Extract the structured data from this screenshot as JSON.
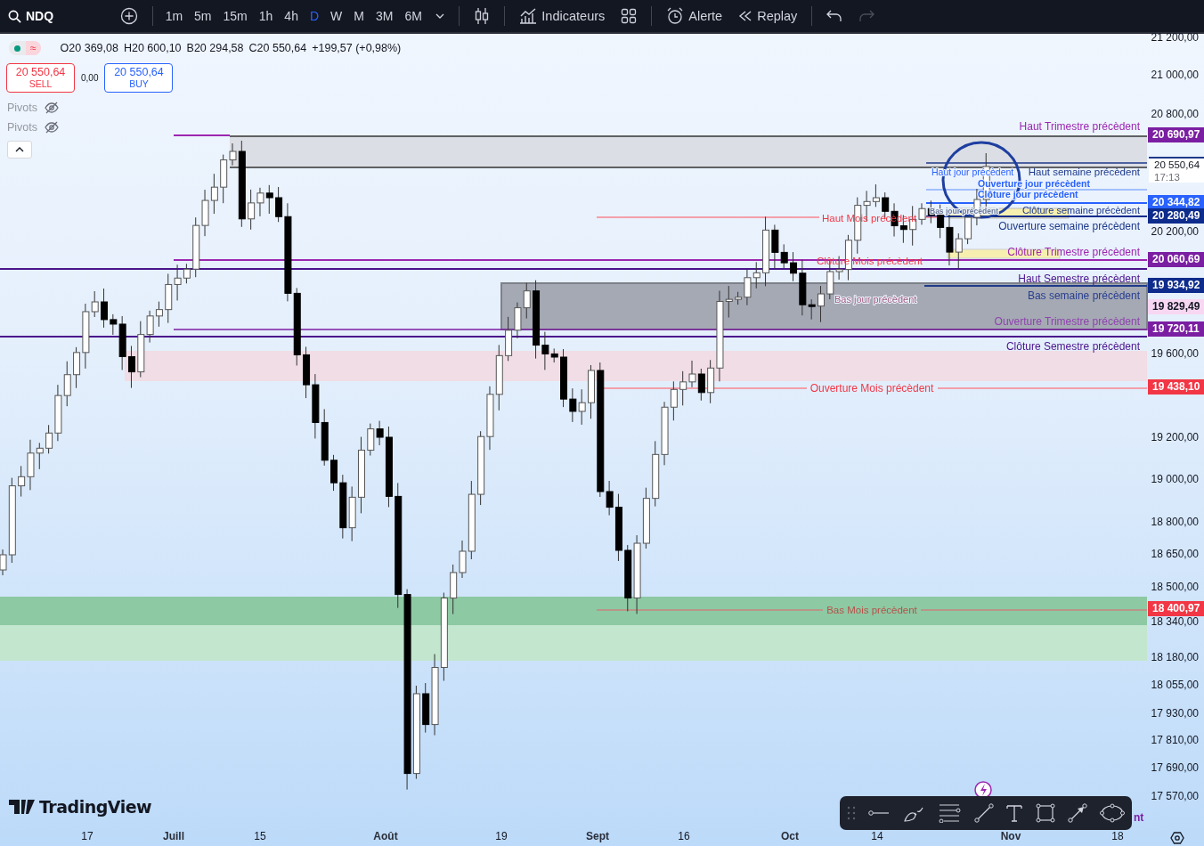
{
  "toolbar": {
    "symbol": "NDQ",
    "intervals": [
      {
        "label": "1m",
        "selected": false
      },
      {
        "label": "5m",
        "selected": false
      },
      {
        "label": "15m",
        "selected": false
      },
      {
        "label": "1h",
        "selected": false
      },
      {
        "label": "4h",
        "selected": false
      },
      {
        "label": "D",
        "selected": true
      },
      {
        "label": "W",
        "selected": false
      },
      {
        "label": "M",
        "selected": false
      },
      {
        "label": "3M",
        "selected": false
      },
      {
        "label": "6M",
        "selected": false
      }
    ],
    "indicators_label": "Indicateurs",
    "alert_label": "Alerte",
    "replay_label": "Replay",
    "redo_disabled": true
  },
  "legend": {
    "status_symbol": "≈",
    "values": [
      {
        "key": "O",
        "value": "20 369,08"
      },
      {
        "key": "H",
        "value": "20 600,10"
      },
      {
        "key": "B",
        "value": "20 294,58"
      },
      {
        "key": "C",
        "value": "20 550,64"
      }
    ],
    "change": "+199,57 (+0,98%)"
  },
  "trade": {
    "sell_price": "20 550,64",
    "sell_label": "SELL",
    "spread": "0,00",
    "buy_price": "20 550,64",
    "buy_label": "BUY"
  },
  "indicators": [
    {
      "name": "Pivots",
      "visible": false
    },
    {
      "name": "Pivots",
      "visible": false
    }
  ],
  "levels": [
    {
      "label": "Haut Trimestre précèdent",
      "color": "#9c27b0"
    },
    {
      "label": "Haut jour précèdent",
      "color": "#2962ff"
    },
    {
      "label": "Haut semaine  précèdent",
      "color": "#1e3a8a"
    },
    {
      "label": "Ouverture jour précèdent",
      "color": "#2962ff"
    },
    {
      "label": "Clôture jour précèdent",
      "color": "#2962ff"
    },
    {
      "label": "Bas jour précèdent",
      "color": "#6b7a99"
    },
    {
      "label": "Clôture semaine  précèdent",
      "color": "#1e3a8a"
    },
    {
      "label": "Ouverture semaine  précèdent",
      "color": "#1e3a8a"
    },
    {
      "label": "Haut Mois précèdent",
      "color": "#f23645"
    },
    {
      "label": "Clôture Trimestre précèdent",
      "color": "#9c27b0"
    },
    {
      "label": "Clôture Mois précèdent",
      "color": "#f23645"
    },
    {
      "label": "Haut Semestre précèdent",
      "color": "#4a148c"
    },
    {
      "label": "Bas jour précèdent",
      "color": "#9c5a80"
    },
    {
      "label": "Bas semaine précèdent",
      "color": "#283e8f"
    },
    {
      "label": "Ouverture Trimestre précèdent",
      "color": "#8e44ad"
    },
    {
      "label": "Clôture Semestre précèdent",
      "color": "#4a148c"
    },
    {
      "label": "Ouverture Mois précèdent",
      "color": "#f23645"
    },
    {
      "label": "Bas Mois précèdent",
      "color": "#b5524a"
    },
    {
      "label": "nt",
      "color": "#7b1fa2"
    }
  ],
  "price_axis": {
    "ticks": [
      "21 200,00",
      "21 000,00",
      "20 800,00",
      "20 200,00",
      "19 600,00",
      "19 200,00",
      "19 000,00",
      "18 800,00",
      "18 650,00",
      "18 500,00",
      "18 340,00",
      "18 180,00",
      "18 055,00",
      "17 930,00",
      "17 810,00",
      "17 690,00",
      "17 570,00"
    ],
    "current": {
      "value": "20 550,64",
      "countdown": "17:13"
    },
    "tags": [
      {
        "value": "20 690,97",
        "color": "#7b1fa2"
      },
      {
        "value": "20 344,82",
        "color": "#2962ff"
      },
      {
        "value": "20 280,49",
        "color": "#0d2c8c"
      },
      {
        "value": "20 060,69",
        "color": "#7b1fa2"
      },
      {
        "value": "19 934,92",
        "color": "#0d2c8c"
      },
      {
        "value": "19 829,49",
        "color": "#f8d7f3"
      },
      {
        "value": "19 720,11",
        "color": "#7b1fa2"
      },
      {
        "value": "19 438,10",
        "color": "#f23645"
      },
      {
        "value": "18 400,97",
        "color": "#f23645"
      }
    ]
  },
  "time_axis": [
    {
      "label": "17",
      "kind": "day"
    },
    {
      "label": "Juill",
      "kind": "month"
    },
    {
      "label": "15",
      "kind": "day"
    },
    {
      "label": "Août",
      "kind": "month"
    },
    {
      "label": "19",
      "kind": "day"
    },
    {
      "label": "Sept",
      "kind": "month"
    },
    {
      "label": "16",
      "kind": "day"
    },
    {
      "label": "Oct",
      "kind": "month"
    },
    {
      "label": "14",
      "kind": "day"
    },
    {
      "label": "Nov",
      "kind": "month"
    },
    {
      "label": "18",
      "kind": "day"
    }
  ],
  "branding": "TradingView"
}
